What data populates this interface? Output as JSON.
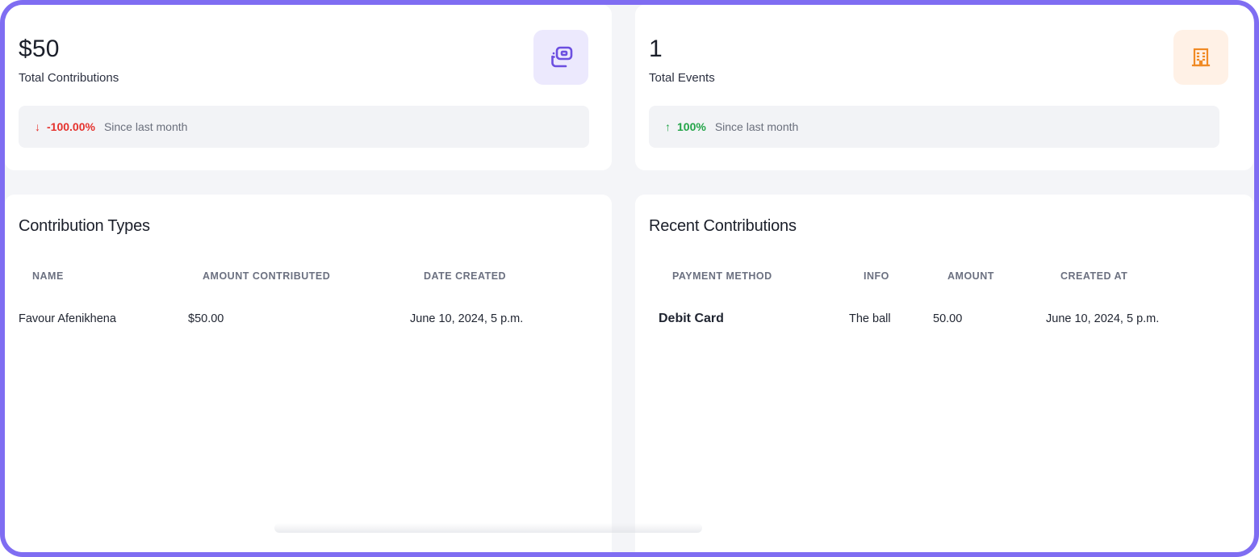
{
  "stats": {
    "contributions": {
      "value": "$50",
      "label": "Total Contributions",
      "icon": "cash-stack-icon",
      "trend_arrow": "↓",
      "trend_pct": "-100.00%",
      "trend_note": "Since last month",
      "trend_color": "#e5322d"
    },
    "events": {
      "value": "1",
      "label": "Total Events",
      "icon": "building-icon",
      "trend_arrow": "↑",
      "trend_pct": "100%",
      "trend_note": "Since last month",
      "trend_color": "#22a447"
    }
  },
  "contribution_types": {
    "title": "Contribution Types",
    "columns": [
      "NAME",
      "AMOUNT CONTRIBUTED",
      "DATE CREATED"
    ],
    "rows": [
      {
        "name": "Favour Afenikhena",
        "amount": "$50.00",
        "date": "June 10, 2024, 5 p.m."
      }
    ]
  },
  "recent_contributions": {
    "title": "Recent Contributions",
    "columns": [
      "PAYMENT METHOD",
      "INFO",
      "AMOUNT",
      "CREATED AT"
    ],
    "rows": [
      {
        "method": "Debit Card",
        "info": "The ball",
        "amount": "50.00",
        "created": "June 10, 2024, 5 p.m."
      }
    ]
  },
  "colors": {
    "frame": "#7f6df2",
    "accent_purple": "#6c4fe0",
    "accent_orange": "#f08a24",
    "background": "#f4f5f8"
  }
}
